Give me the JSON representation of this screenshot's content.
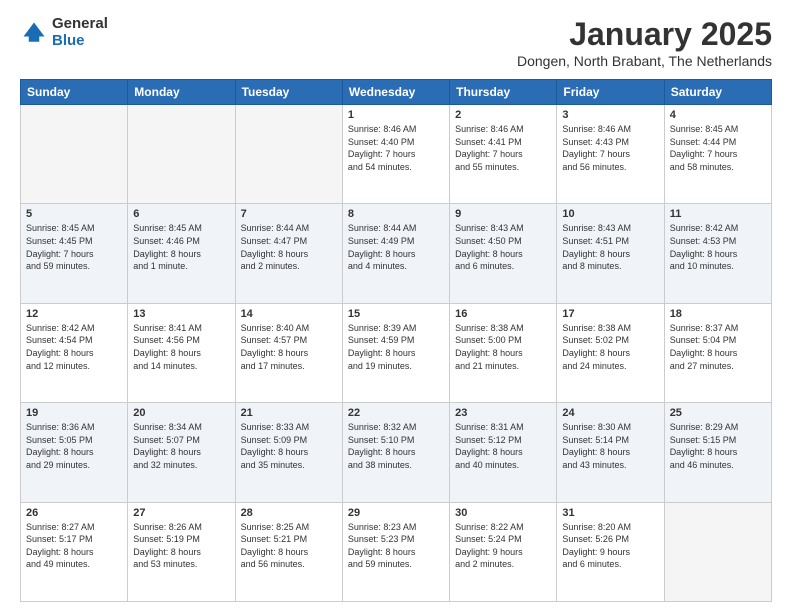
{
  "logo": {
    "general": "General",
    "blue": "Blue"
  },
  "title": {
    "month": "January 2025",
    "location": "Dongen, North Brabant, The Netherlands"
  },
  "headers": [
    "Sunday",
    "Monday",
    "Tuesday",
    "Wednesday",
    "Thursday",
    "Friday",
    "Saturday"
  ],
  "weeks": [
    [
      {
        "day": "",
        "info": ""
      },
      {
        "day": "",
        "info": ""
      },
      {
        "day": "",
        "info": ""
      },
      {
        "day": "1",
        "info": "Sunrise: 8:46 AM\nSunset: 4:40 PM\nDaylight: 7 hours\nand 54 minutes."
      },
      {
        "day": "2",
        "info": "Sunrise: 8:46 AM\nSunset: 4:41 PM\nDaylight: 7 hours\nand 55 minutes."
      },
      {
        "day": "3",
        "info": "Sunrise: 8:46 AM\nSunset: 4:43 PM\nDaylight: 7 hours\nand 56 minutes."
      },
      {
        "day": "4",
        "info": "Sunrise: 8:45 AM\nSunset: 4:44 PM\nDaylight: 7 hours\nand 58 minutes."
      }
    ],
    [
      {
        "day": "5",
        "info": "Sunrise: 8:45 AM\nSunset: 4:45 PM\nDaylight: 7 hours\nand 59 minutes."
      },
      {
        "day": "6",
        "info": "Sunrise: 8:45 AM\nSunset: 4:46 PM\nDaylight: 8 hours\nand 1 minute."
      },
      {
        "day": "7",
        "info": "Sunrise: 8:44 AM\nSunset: 4:47 PM\nDaylight: 8 hours\nand 2 minutes."
      },
      {
        "day": "8",
        "info": "Sunrise: 8:44 AM\nSunset: 4:49 PM\nDaylight: 8 hours\nand 4 minutes."
      },
      {
        "day": "9",
        "info": "Sunrise: 8:43 AM\nSunset: 4:50 PM\nDaylight: 8 hours\nand 6 minutes."
      },
      {
        "day": "10",
        "info": "Sunrise: 8:43 AM\nSunset: 4:51 PM\nDaylight: 8 hours\nand 8 minutes."
      },
      {
        "day": "11",
        "info": "Sunrise: 8:42 AM\nSunset: 4:53 PM\nDaylight: 8 hours\nand 10 minutes."
      }
    ],
    [
      {
        "day": "12",
        "info": "Sunrise: 8:42 AM\nSunset: 4:54 PM\nDaylight: 8 hours\nand 12 minutes."
      },
      {
        "day": "13",
        "info": "Sunrise: 8:41 AM\nSunset: 4:56 PM\nDaylight: 8 hours\nand 14 minutes."
      },
      {
        "day": "14",
        "info": "Sunrise: 8:40 AM\nSunset: 4:57 PM\nDaylight: 8 hours\nand 17 minutes."
      },
      {
        "day": "15",
        "info": "Sunrise: 8:39 AM\nSunset: 4:59 PM\nDaylight: 8 hours\nand 19 minutes."
      },
      {
        "day": "16",
        "info": "Sunrise: 8:38 AM\nSunset: 5:00 PM\nDaylight: 8 hours\nand 21 minutes."
      },
      {
        "day": "17",
        "info": "Sunrise: 8:38 AM\nSunset: 5:02 PM\nDaylight: 8 hours\nand 24 minutes."
      },
      {
        "day": "18",
        "info": "Sunrise: 8:37 AM\nSunset: 5:04 PM\nDaylight: 8 hours\nand 27 minutes."
      }
    ],
    [
      {
        "day": "19",
        "info": "Sunrise: 8:36 AM\nSunset: 5:05 PM\nDaylight: 8 hours\nand 29 minutes."
      },
      {
        "day": "20",
        "info": "Sunrise: 8:34 AM\nSunset: 5:07 PM\nDaylight: 8 hours\nand 32 minutes."
      },
      {
        "day": "21",
        "info": "Sunrise: 8:33 AM\nSunset: 5:09 PM\nDaylight: 8 hours\nand 35 minutes."
      },
      {
        "day": "22",
        "info": "Sunrise: 8:32 AM\nSunset: 5:10 PM\nDaylight: 8 hours\nand 38 minutes."
      },
      {
        "day": "23",
        "info": "Sunrise: 8:31 AM\nSunset: 5:12 PM\nDaylight: 8 hours\nand 40 minutes."
      },
      {
        "day": "24",
        "info": "Sunrise: 8:30 AM\nSunset: 5:14 PM\nDaylight: 8 hours\nand 43 minutes."
      },
      {
        "day": "25",
        "info": "Sunrise: 8:29 AM\nSunset: 5:15 PM\nDaylight: 8 hours\nand 46 minutes."
      }
    ],
    [
      {
        "day": "26",
        "info": "Sunrise: 8:27 AM\nSunset: 5:17 PM\nDaylight: 8 hours\nand 49 minutes."
      },
      {
        "day": "27",
        "info": "Sunrise: 8:26 AM\nSunset: 5:19 PM\nDaylight: 8 hours\nand 53 minutes."
      },
      {
        "day": "28",
        "info": "Sunrise: 8:25 AM\nSunset: 5:21 PM\nDaylight: 8 hours\nand 56 minutes."
      },
      {
        "day": "29",
        "info": "Sunrise: 8:23 AM\nSunset: 5:23 PM\nDaylight: 8 hours\nand 59 minutes."
      },
      {
        "day": "30",
        "info": "Sunrise: 8:22 AM\nSunset: 5:24 PM\nDaylight: 9 hours\nand 2 minutes."
      },
      {
        "day": "31",
        "info": "Sunrise: 8:20 AM\nSunset: 5:26 PM\nDaylight: 9 hours\nand 6 minutes."
      },
      {
        "day": "",
        "info": ""
      }
    ]
  ]
}
